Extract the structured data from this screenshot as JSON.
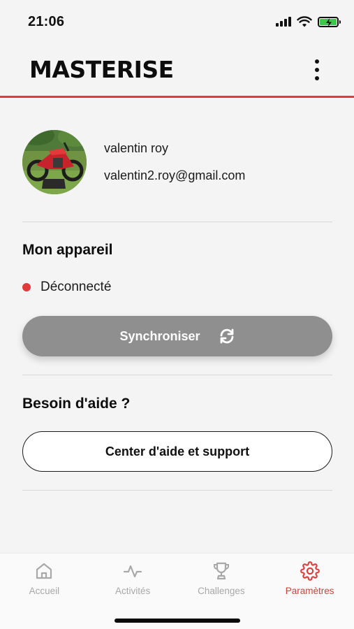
{
  "status_bar": {
    "time": "21:06"
  },
  "header": {
    "brand": "MASTERISE",
    "menu_icon": "more-vertical-icon"
  },
  "profile": {
    "name": "valentin roy",
    "email": "valentin2.roy@gmail.com",
    "avatar_icon": "motorbike-photo"
  },
  "device": {
    "title": "Mon appareil",
    "status": "Déconnecté",
    "status_color": "#e03a3a",
    "sync_label": "Synchroniser",
    "sync_icon": "refresh-icon"
  },
  "help": {
    "title": "Besoin d'aide ?",
    "button_label": "Center d'aide et support"
  },
  "tabs": [
    {
      "label": "Accueil",
      "icon": "home-icon",
      "active": false
    },
    {
      "label": "Activités",
      "icon": "activity-icon",
      "active": false
    },
    {
      "label": "Challenges",
      "icon": "trophy-icon",
      "active": false
    },
    {
      "label": "Paramètres",
      "icon": "gear-icon",
      "active": true
    }
  ],
  "colors": {
    "accent": "#e03a3a",
    "sync_button": "#8f8f8f",
    "background": "#f4f4f4",
    "tab_inactive": "#a8a8a8"
  }
}
